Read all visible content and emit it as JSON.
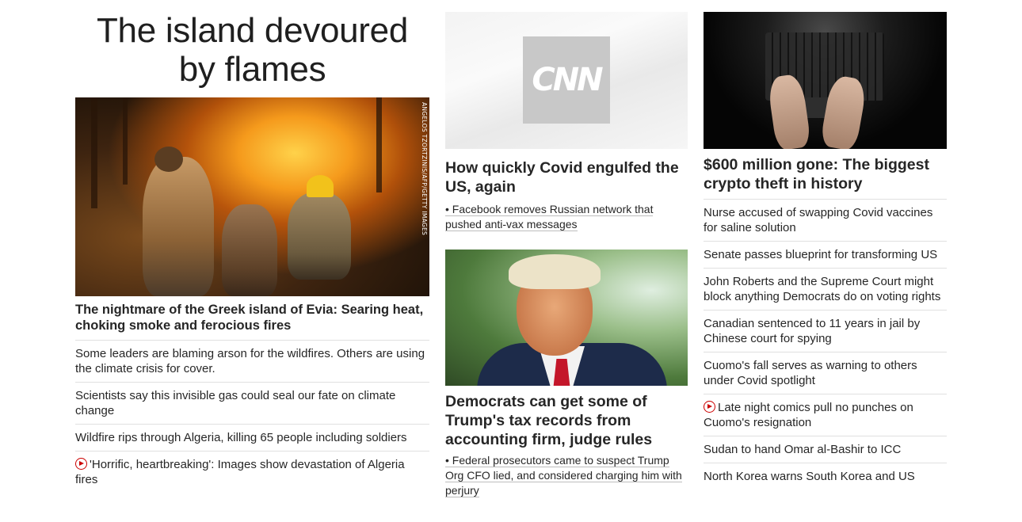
{
  "col1": {
    "section_title": "The island devoured by flames",
    "hero_credit": "ANGELOS TZORTZINIS/AFP/GETTY IMAGES",
    "hero_headline": "The nightmare of the Greek island of Evia: Searing heat, choking smoke and ferocious fires",
    "links": [
      {
        "text": "Some leaders are blaming arson for the wildfires. Others are using the climate crisis for cover.",
        "video": false
      },
      {
        "text": "Scientists say this invisible gas could seal our fate on climate change",
        "video": false
      },
      {
        "text": "Wildfire rips through Algeria, killing 65 people including soldiers",
        "video": false
      },
      {
        "text": "'Horrific, heartbreaking': Images show devastation of Algeria fires",
        "video": true
      }
    ]
  },
  "col2": {
    "logo_text": "CNN",
    "story1": {
      "headline": "How quickly Covid engulfed the US, again",
      "sublink": "• Facebook removes Russian network that pushed anti-vax messages"
    },
    "story2": {
      "headline": "Democrats can get some of Trump's tax records from accounting firm, judge rules",
      "sublink": "• Federal prosecutors came to suspect Trump Org CFO lied, and considered charging him with perjury"
    }
  },
  "col3": {
    "headline": "$600 million gone: The biggest crypto theft in history",
    "links": [
      {
        "text": "Nurse accused of swapping Covid vaccines for saline solution",
        "video": false
      },
      {
        "text": "Senate passes blueprint for transforming US",
        "video": false
      },
      {
        "text": "John Roberts and the Supreme Court might block anything Democrats do on voting rights",
        "video": false
      },
      {
        "text": "Canadian sentenced to 11 years in jail by Chinese court for spying",
        "video": false
      },
      {
        "text": "Cuomo's fall serves as warning to others under Covid spotlight",
        "video": false
      },
      {
        "text": "Late night comics pull no punches on Cuomo's resignation",
        "video": true
      },
      {
        "text": "Sudan to hand Omar al-Bashir to ICC",
        "video": false
      },
      {
        "text": "North Korea warns South Korea and US",
        "video": false
      }
    ]
  },
  "colors": {
    "text": "#262626",
    "divider": "#e0e0e0",
    "video_icon": "#cc0000",
    "logo_bg": "#c8c8c8"
  }
}
